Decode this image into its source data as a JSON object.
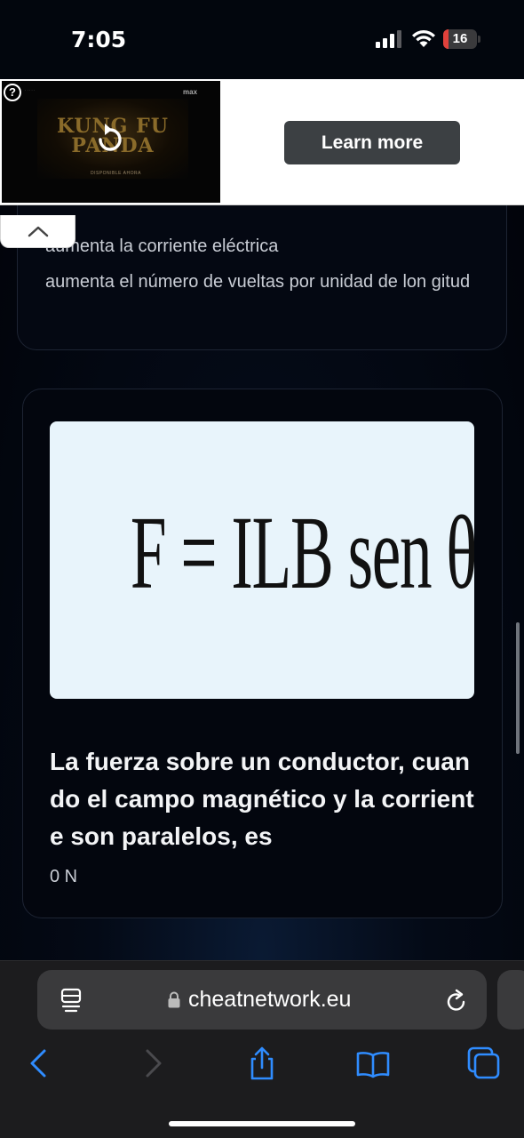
{
  "status_bar": {
    "time": "7:05",
    "battery_level": "16",
    "battery_fraction": 0.16,
    "battery_color": "#e0413b"
  },
  "ad": {
    "learn_more_label": "Learn more",
    "help_glyph": "?",
    "logo_text": "KUNG FU PANDA",
    "tagline": "DISPONIBLE AHORA",
    "network_logo": "max",
    "icons": [
      "help-icon",
      "replay-icon",
      "chevron-up-icon"
    ]
  },
  "card_top": {
    "options": [
      "aumenta la corriente eléctrica",
      "aumenta el número de vueltas por unidad de lon gitud"
    ]
  },
  "card_main": {
    "formula": "F = ILB sen θ",
    "question": "La fuerza sobre un conductor, cuando el campo magnético y la corriente son paralelos, es",
    "answer": "0 N"
  },
  "browser": {
    "url": "cheatnetwork.eu",
    "icons": [
      "page-menu-icon",
      "lock-icon",
      "reload-icon",
      "back-icon",
      "forward-icon",
      "share-icon",
      "bookmarks-icon",
      "tabs-icon"
    ]
  }
}
